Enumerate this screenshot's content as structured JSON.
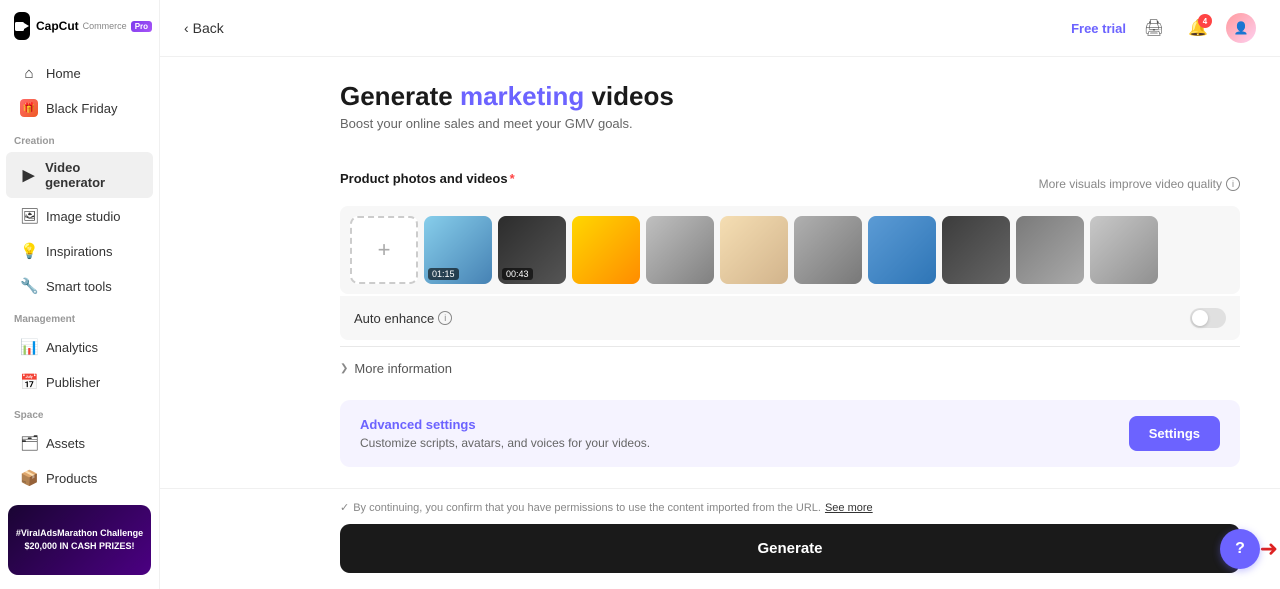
{
  "app": {
    "name": "CapCut",
    "subbrand": "Commerce",
    "pro_badge": "Pro"
  },
  "sidebar": {
    "home_label": "Home",
    "black_friday_label": "Black Friday",
    "sections": [
      {
        "label": "Creation",
        "items": [
          {
            "id": "video-generator",
            "label": "Video generator",
            "active": true
          },
          {
            "id": "image-studio",
            "label": "Image studio"
          },
          {
            "id": "inspirations",
            "label": "Inspirations"
          },
          {
            "id": "smart-tools",
            "label": "Smart tools"
          }
        ]
      },
      {
        "label": "Management",
        "items": [
          {
            "id": "analytics",
            "label": "Analytics"
          },
          {
            "id": "publisher",
            "label": "Publisher"
          }
        ]
      },
      {
        "label": "Space",
        "items": [
          {
            "id": "assets",
            "label": "Assets"
          },
          {
            "id": "products",
            "label": "Products"
          }
        ]
      }
    ],
    "promo": {
      "line1": "#ViralAdsMarathon Challenge",
      "line2": "$20,000 IN CASH PRIZES!"
    }
  },
  "header": {
    "back_label": "Back",
    "free_trial_label": "Free trial",
    "notification_count": "4"
  },
  "page": {
    "title_part1": "Generate ",
    "title_highlight": "marketing",
    "title_part2": " videos",
    "subtitle": "Boost your online sales and meet your GMV goals."
  },
  "product_photos": {
    "section_label": "Product photos and videos",
    "quality_hint": "More visuals improve video quality",
    "add_btn_label": "+",
    "media_items": [
      {
        "id": "v1",
        "type": "video",
        "duration": "01:15",
        "thumb_class": "thumb-1"
      },
      {
        "id": "v2",
        "type": "video",
        "duration": "00:43",
        "thumb_class": "thumb-2"
      },
      {
        "id": "p1",
        "type": "photo",
        "thumb_class": "thumb-3"
      },
      {
        "id": "p2",
        "type": "photo",
        "thumb_class": "thumb-4"
      },
      {
        "id": "p3",
        "type": "photo",
        "thumb_class": "thumb-5"
      },
      {
        "id": "p4",
        "type": "photo",
        "thumb_class": "thumb-6"
      },
      {
        "id": "p5",
        "type": "photo",
        "thumb_class": "thumb-7"
      },
      {
        "id": "p6",
        "type": "photo",
        "thumb_class": "thumb-8"
      },
      {
        "id": "p7",
        "type": "photo",
        "thumb_class": "thumb-9"
      },
      {
        "id": "p8",
        "type": "photo",
        "thumb_class": "thumb-10"
      }
    ]
  },
  "auto_enhance": {
    "label": "Auto enhance",
    "enabled": false
  },
  "more_information": {
    "label": "More information"
  },
  "advanced_settings": {
    "title": "Advanced settings",
    "subtitle": "Customize scripts, avatars, and voices for your videos.",
    "button_label": "Settings"
  },
  "footer": {
    "disclaimer_text": "By continuing, you confirm that you have permissions to use the content imported from the URL.",
    "see_more_label": "See more",
    "generate_label": "Generate"
  },
  "help": {
    "label": "?"
  }
}
